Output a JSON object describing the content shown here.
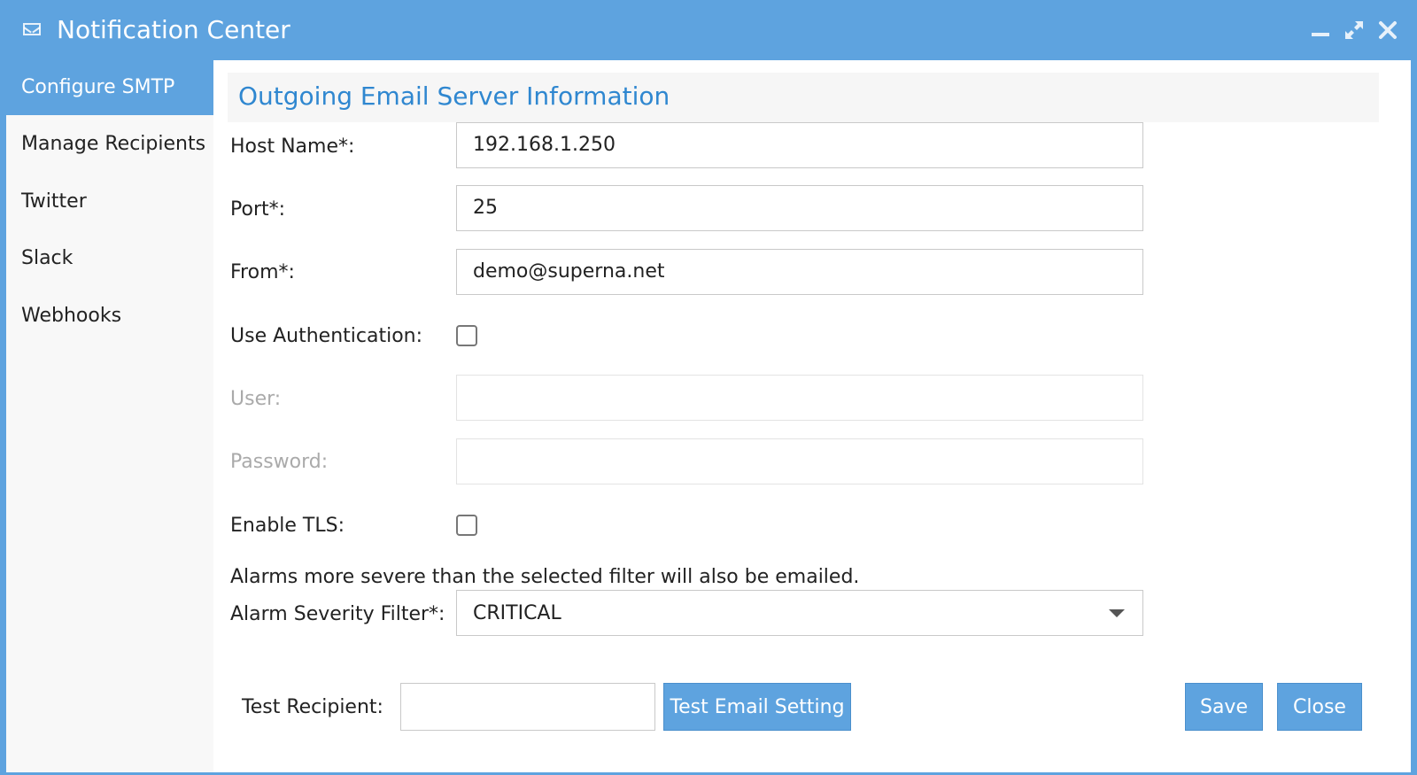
{
  "window": {
    "title": "Notification Center",
    "icon": "envelope-icon",
    "controls": [
      "minimize-icon",
      "maximize-icon",
      "close-icon"
    ],
    "accent_color": "#5ea3df"
  },
  "sidebar": {
    "items": [
      {
        "label": "Configure SMTP",
        "active": true
      },
      {
        "label": "Manage Recipients",
        "active": false
      },
      {
        "label": "Twitter",
        "active": false
      },
      {
        "label": "Slack",
        "active": false
      },
      {
        "label": "Webhooks",
        "active": false
      }
    ]
  },
  "form": {
    "section_title": "Outgoing Email Server Information",
    "host_name": {
      "label": "Host Name*:",
      "value": "192.168.1.250"
    },
    "port": {
      "label": "Port*:",
      "value": "25"
    },
    "from": {
      "label": "From*:",
      "value": "demo@superna.net"
    },
    "use_authentication": {
      "label": "Use Authentication:",
      "checked": false
    },
    "user": {
      "label": "User:",
      "value": "",
      "disabled": true
    },
    "password": {
      "label": "Password:",
      "value": "",
      "disabled": true
    },
    "enable_tls": {
      "label": "Enable TLS:",
      "checked": false
    },
    "severity_note": "Alarms more severe than the selected filter will also be emailed.",
    "alarm_severity": {
      "label": "Alarm Severity Filter*:",
      "value": "CRITICAL"
    }
  },
  "footer": {
    "test_recipient_label": "Test Recipient:",
    "test_recipient_value": "",
    "test_button": "Test Email Setting",
    "save_button": "Save",
    "close_button": "Close"
  }
}
